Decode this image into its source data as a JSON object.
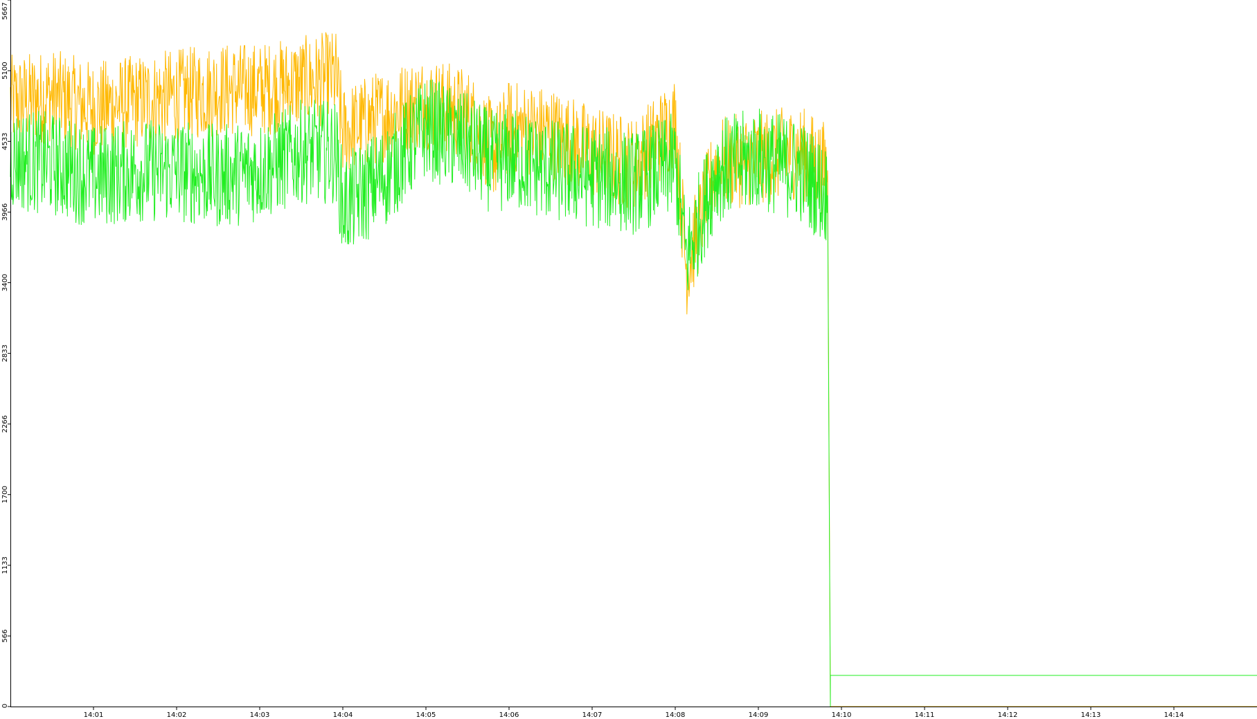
{
  "chart_data": {
    "type": "line",
    "title": "",
    "xlabel": "",
    "ylabel": "",
    "grid": false,
    "legend": "none",
    "ylim": [
      0,
      5667
    ],
    "xlim": [
      "14:00:00",
      "14:15:00"
    ],
    "y_ticks": [
      0,
      566,
      1133,
      1700,
      2266,
      2833,
      3400,
      3966,
      4533,
      5100,
      5667
    ],
    "x_ticks": [
      "14:01",
      "14:02",
      "14:03",
      "14:04",
      "14:05",
      "14:06",
      "14:07",
      "14:08",
      "14:09",
      "14:10",
      "14:11",
      "14:12",
      "14:13",
      "14:14"
    ],
    "x": [
      "14:00:00",
      "14:00:30",
      "14:01:00",
      "14:01:30",
      "14:02:00",
      "14:02:30",
      "14:03:00",
      "14:03:30",
      "14:03:55",
      "14:04:00",
      "14:04:30",
      "14:05:00",
      "14:05:30",
      "14:05:50",
      "14:06:00",
      "14:06:30",
      "14:07:00",
      "14:07:30",
      "14:08:00",
      "14:08:08",
      "14:08:30",
      "14:09:00",
      "14:09:30",
      "14:09:50",
      "14:09:52",
      "14:10:00",
      "14:11:00",
      "14:12:00",
      "14:13:00",
      "14:14:00",
      "14:15:00"
    ],
    "series": [
      {
        "color": "#ffb800",
        "values": [
          4850,
          4900,
          4800,
          4850,
          4900,
          4950,
          4950,
          5000,
          5050,
          4600,
          4750,
          4850,
          4750,
          4450,
          4650,
          4600,
          4450,
          4350,
          4700,
          3500,
          4350,
          4400,
          4450,
          4300,
          0,
          0,
          0,
          0,
          0,
          0,
          0
        ]
      },
      {
        "color": "#22ee22",
        "values": [
          4400,
          4350,
          4250,
          4300,
          4300,
          4250,
          4300,
          4450,
          4450,
          4000,
          4250,
          4650,
          4500,
          4350,
          4400,
          4300,
          4250,
          4200,
          4350,
          3600,
          4300,
          4400,
          4300,
          4100,
          250,
          250,
          250,
          250,
          250,
          250,
          250
        ]
      }
    ]
  }
}
